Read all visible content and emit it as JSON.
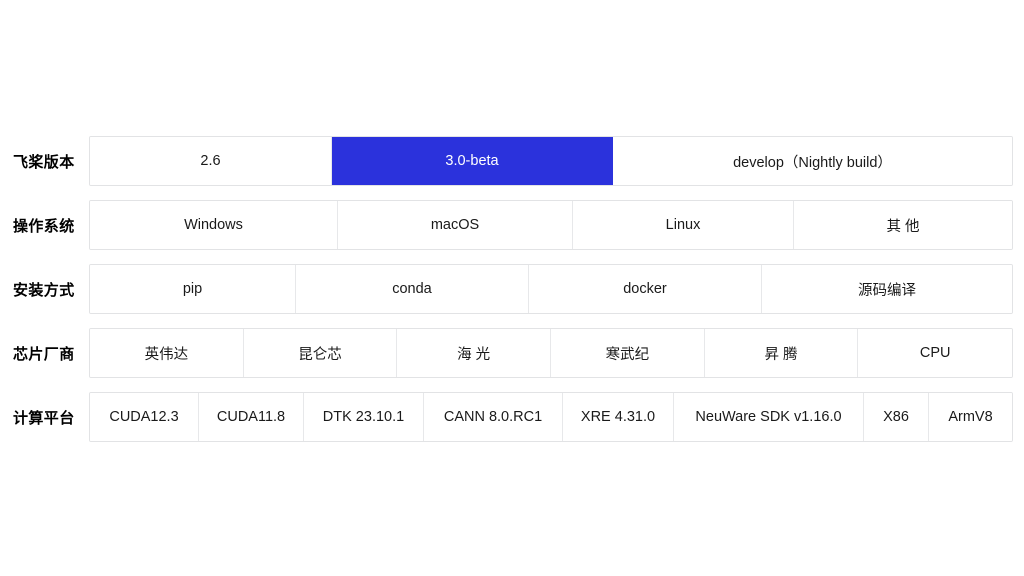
{
  "theme": {
    "background": "#ffffff",
    "accent": "#2b32dc",
    "border": "#e2e3e5",
    "divider": "#e7e8ea",
    "text": "#1a1a1a",
    "selected_text": "#ffffff"
  },
  "selector": {
    "rows": [
      {
        "id": "paddle-version",
        "label": "飞桨版本",
        "options": [
          {
            "label": "2.6",
            "selected": false
          },
          {
            "label": "3.0-beta",
            "selected": true
          },
          {
            "label": "develop（Nightly build）",
            "selected": false
          }
        ]
      },
      {
        "id": "operating-system",
        "label": "操作系统",
        "options": [
          {
            "label": "Windows",
            "selected": false
          },
          {
            "label": "macOS",
            "selected": false
          },
          {
            "label": "Linux",
            "selected": false
          },
          {
            "label": "其 他",
            "selected": false
          }
        ]
      },
      {
        "id": "install-method",
        "label": "安装方式",
        "options": [
          {
            "label": "pip",
            "selected": false
          },
          {
            "label": "conda",
            "selected": false
          },
          {
            "label": "docker",
            "selected": false
          },
          {
            "label": "源码编译",
            "selected": false
          }
        ]
      },
      {
        "id": "chip-vendor",
        "label": "芯片厂商",
        "options": [
          {
            "label": "英伟达",
            "selected": false
          },
          {
            "label": "昆仑芯",
            "selected": false
          },
          {
            "label": "海 光",
            "selected": false
          },
          {
            "label": "寒武纪",
            "selected": false
          },
          {
            "label": "昇 腾",
            "selected": false
          },
          {
            "label": "CPU",
            "selected": false
          }
        ]
      },
      {
        "id": "compute-platform",
        "label": "计算平台",
        "options": [
          {
            "label": "CUDA12.3",
            "selected": false
          },
          {
            "label": "CUDA11.8",
            "selected": false
          },
          {
            "label": "DTK 23.10.1",
            "selected": false
          },
          {
            "label": "CANN 8.0.RC1",
            "selected": false
          },
          {
            "label": "XRE 4.31.0",
            "selected": false
          },
          {
            "label": "NeuWare SDK v1.16.0",
            "selected": false
          },
          {
            "label": "X86",
            "selected": false
          },
          {
            "label": "ArmV8",
            "selected": false
          }
        ]
      }
    ]
  }
}
